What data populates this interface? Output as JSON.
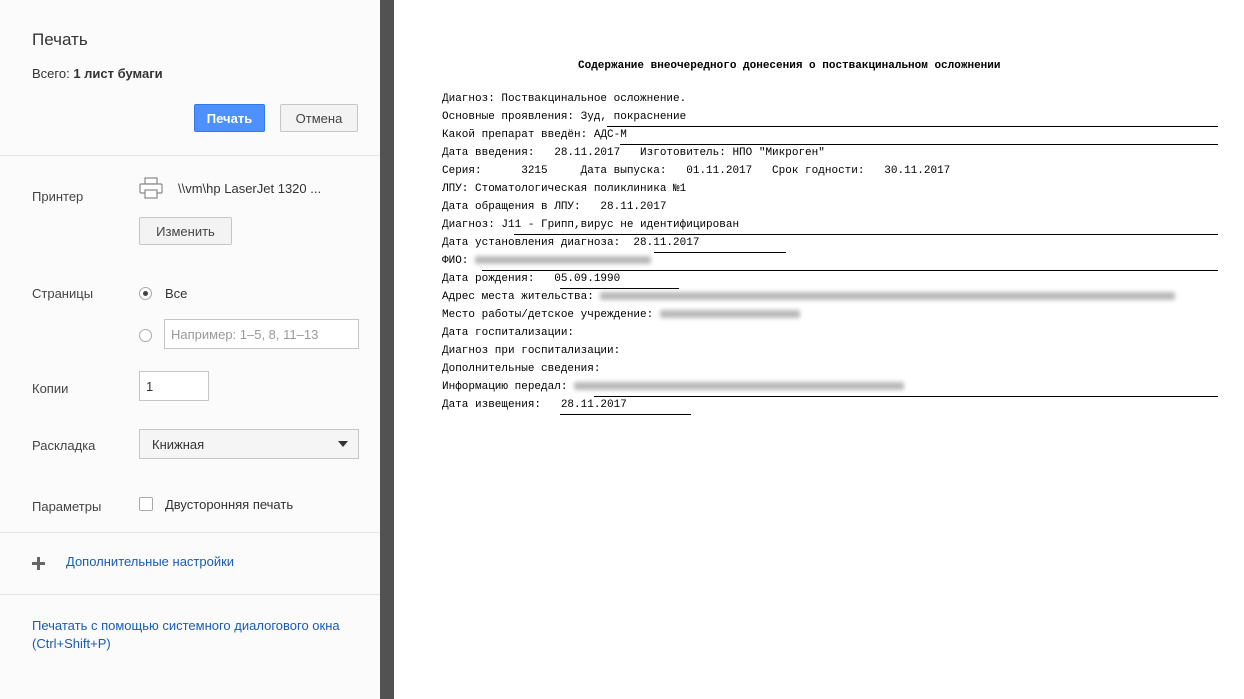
{
  "panel": {
    "title": "Печать",
    "total_label": "Всего:",
    "total_value": "1 лист бумаги",
    "print_button": "Печать",
    "cancel_button": "Отмена",
    "printer_label": "Принтер",
    "printer_name": "\\\\vm\\hp LaserJet 1320 ...",
    "change_button": "Изменить",
    "pages_label": "Страницы",
    "pages_all": "Все",
    "pages_placeholder": "Например: 1–5, 8, 11–13",
    "copies_label": "Копии",
    "copies_value": "1",
    "layout_label": "Раскладка",
    "layout_value": "Книжная",
    "params_label": "Параметры",
    "duplex_label": "Двусторонняя печать",
    "more_settings": "Дополнительные настройки",
    "system_dialog": "Печатать с помощью системного диалогового окна (Ctrl+Shift+P)"
  },
  "document": {
    "title": "Содержание внеочередного донесения о поствакцинальном осложнении",
    "lines": [
      "Диагноз: Поствакцинальное осложнение.",
      "Основные проявления: Зуд, покраснение",
      "Какой препарат введён: АДС-М",
      "Дата введения:   28.11.2017   Изготовитель: НПО \"Микроген\"",
      "Серия:      3215     Дата выпуска:   01.11.2017   Срок годности:   30.11.2017",
      "ЛПУ: Стоматологическая поликлиника №1",
      "Дата обращения в ЛПУ:   28.11.2017",
      "Диагноз: J11 - Грипп,вирус не идентифицирован",
      "Дата установления диагноза:  28.11.2017",
      "ФИО:",
      "Дата рождения:   05.09.1990",
      "Адрес места жительства:",
      "Место работы/детское учреждение:",
      "Дата госпитализации:",
      "Диагноз при госпитализации:",
      "Дополнительные сведения:",
      "Информацию передал:",
      "Дата извещения:   28.11.2017"
    ]
  },
  "colors": {
    "primary_button": "#4d90fe",
    "link": "#1a5bb6",
    "divider": "#525252"
  }
}
